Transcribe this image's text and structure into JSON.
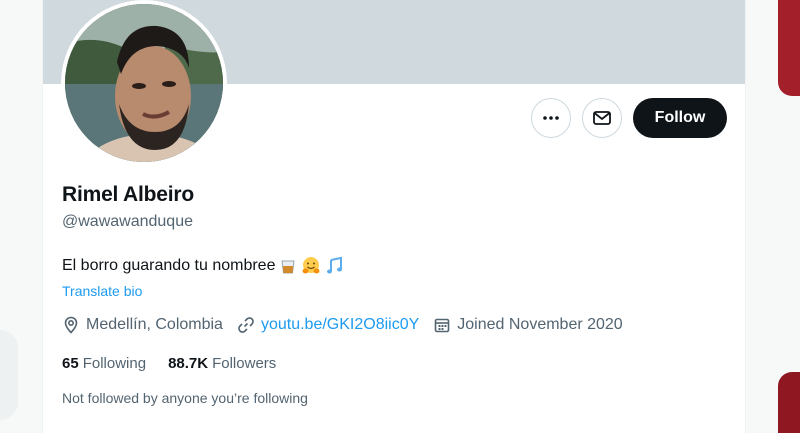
{
  "profile": {
    "name": "Rimel Albeiro",
    "handle": "@wawawanduque",
    "bio": "El borro guarando tu nombree",
    "translate_label": "Translate bio",
    "location": "Medellín, Colombia",
    "link": "youtu.be/GKI2O8iic0Y",
    "joined": "Joined November 2020",
    "following_count": "65",
    "following_label": "Following",
    "followers_count": "88.7K",
    "followers_label": "Followers",
    "mutuals_note": "Not followed by anyone you’re following"
  },
  "actions": {
    "follow_label": "Follow"
  },
  "icons": {
    "more": "more-icon",
    "message": "envelope-icon",
    "location": "location-pin-icon",
    "link": "link-icon",
    "calendar": "calendar-icon",
    "bio_emojis": [
      "tumbler-glass-emoji",
      "hugging-face-emoji",
      "musical-notes-emoji"
    ]
  },
  "colors": {
    "accent": "#1d9bf0",
    "follow_button": "#0f1419",
    "banner": "#cfd9de"
  }
}
